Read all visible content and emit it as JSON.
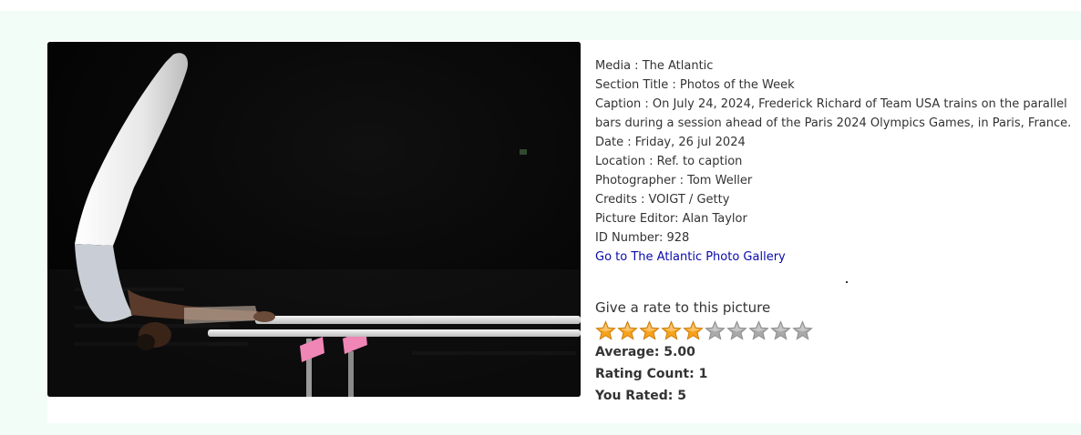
{
  "info": {
    "media": "Media : The Atlantic",
    "section": "Section Title : Photos of the Week",
    "caption": "Caption : On July 24, 2024, Frederick Richard of Team USA trains on the parallel bars during a session ahead of the Paris 2024 Olympics Games, in Paris, France.",
    "date": "Date : Friday, 26 jul 2024",
    "location": "Location : Ref. to caption",
    "photographer": "Photographer : Tom Weller",
    "credits": "Credits : VOIGT / Getty",
    "editor": "Picture Editor: Alan Taylor",
    "id_number": "ID Number: 928",
    "gallery_link": "Go to The Atlantic Photo Gallery"
  },
  "rating": {
    "title": "Give a rate to this picture",
    "max_stars": 10,
    "filled_stars": 5,
    "average": "Average: 5.00",
    "count": "Rating Count: 1",
    "you_rated": "You Rated: 5"
  },
  "colors": {
    "star_filled": "#f7a21b",
    "star_empty": "#a9a9a9",
    "link": "#0a0aaa",
    "background_band": "#f2fdf7"
  },
  "icons": [
    "star-icon"
  ]
}
